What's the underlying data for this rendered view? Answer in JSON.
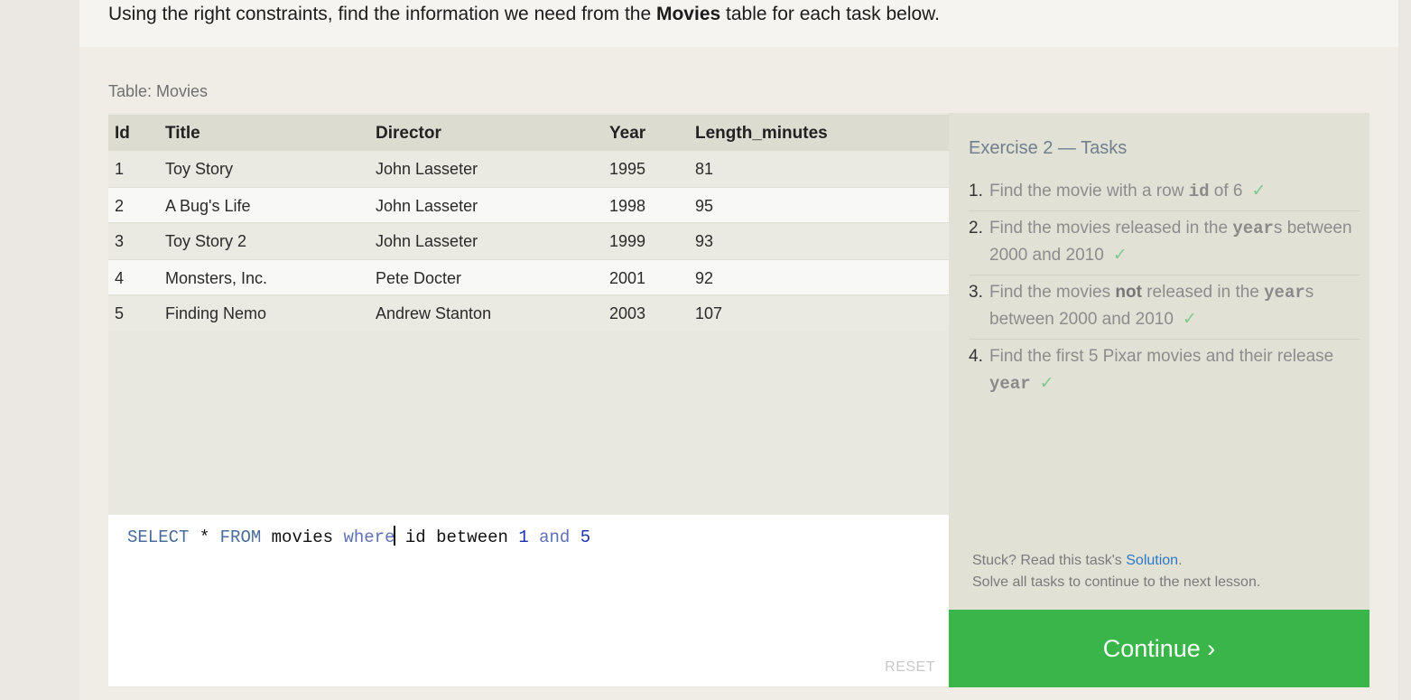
{
  "instruction": {
    "before": "Using the right constraints, find the information we need from the ",
    "table_name": "Movies",
    "after": " table for each task below."
  },
  "table": {
    "caption": "Table: Movies",
    "columns": [
      "Id",
      "Title",
      "Director",
      "Year",
      "Length_minutes"
    ],
    "rows": [
      [
        "1",
        "Toy Story",
        "John Lasseter",
        "1995",
        "81"
      ],
      [
        "2",
        "A Bug's Life",
        "John Lasseter",
        "1998",
        "95"
      ],
      [
        "3",
        "Toy Story 2",
        "John Lasseter",
        "1999",
        "93"
      ],
      [
        "4",
        "Monsters, Inc.",
        "Pete Docter",
        "2001",
        "92"
      ],
      [
        "5",
        "Finding Nemo",
        "Andrew Stanton",
        "2003",
        "107"
      ]
    ]
  },
  "editor": {
    "tokens": {
      "select": "SELECT",
      "star": " * ",
      "from": "FROM",
      "table": " movies ",
      "where": "where",
      "rest": " id between ",
      "n1": "1",
      "and": " and ",
      "n2": "5"
    },
    "reset_label": "RESET"
  },
  "tasks": {
    "title": "Exercise 2 — Tasks",
    "items": [
      {
        "num": "1.",
        "a": "Find the movie with a row ",
        "code": "id",
        "b": " of 6"
      },
      {
        "num": "2.",
        "a": "Find the movies released in the ",
        "code": "year",
        "b": "s between 2000 and 2010"
      },
      {
        "num": "3.",
        "a": "Find the movies ",
        "bold": "not",
        "a2": " released in the ",
        "code": "year",
        "b": "s between 2000 and 2010"
      },
      {
        "num": "4.",
        "a": "Find the first 5 Pixar movies and their release ",
        "code": "year",
        "b": ""
      }
    ],
    "check": "✓",
    "help_prefix": "Stuck? Read this task's ",
    "solution_link": "Solution",
    "help_suffix": ".",
    "help_line2": "Solve all tasks to continue to the next lesson."
  },
  "continue_label": "Continue ›",
  "colors": {
    "continue": "#3ab54a",
    "link": "#2c78c8",
    "check": "#7ec98e"
  }
}
